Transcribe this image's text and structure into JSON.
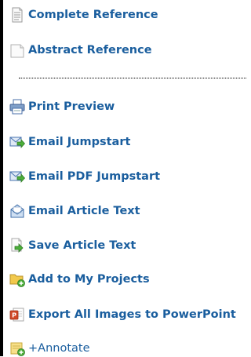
{
  "menu": {
    "items": [
      {
        "label": "Complete Reference",
        "icon": "document-lines-icon"
      },
      {
        "label": "Abstract Reference",
        "icon": "document-blank-icon"
      },
      {
        "label": "Print Preview",
        "icon": "printer-icon"
      },
      {
        "label": "Email Jumpstart",
        "icon": "email-arrow-icon"
      },
      {
        "label": "Email PDF Jumpstart",
        "icon": "email-arrow-icon"
      },
      {
        "label": "Email Article Text",
        "icon": "email-open-icon"
      },
      {
        "label": "Save Article Text",
        "icon": "save-arrow-icon"
      },
      {
        "label": "Add to My Projects",
        "icon": "folder-add-icon"
      },
      {
        "label": "Export All Images to PowerPoint",
        "icon": "powerpoint-icon"
      },
      {
        "label": "+Annotate",
        "icon": "annotate-icon"
      }
    ]
  },
  "colors": {
    "link": "#1a5e9e",
    "border": "#000000"
  }
}
